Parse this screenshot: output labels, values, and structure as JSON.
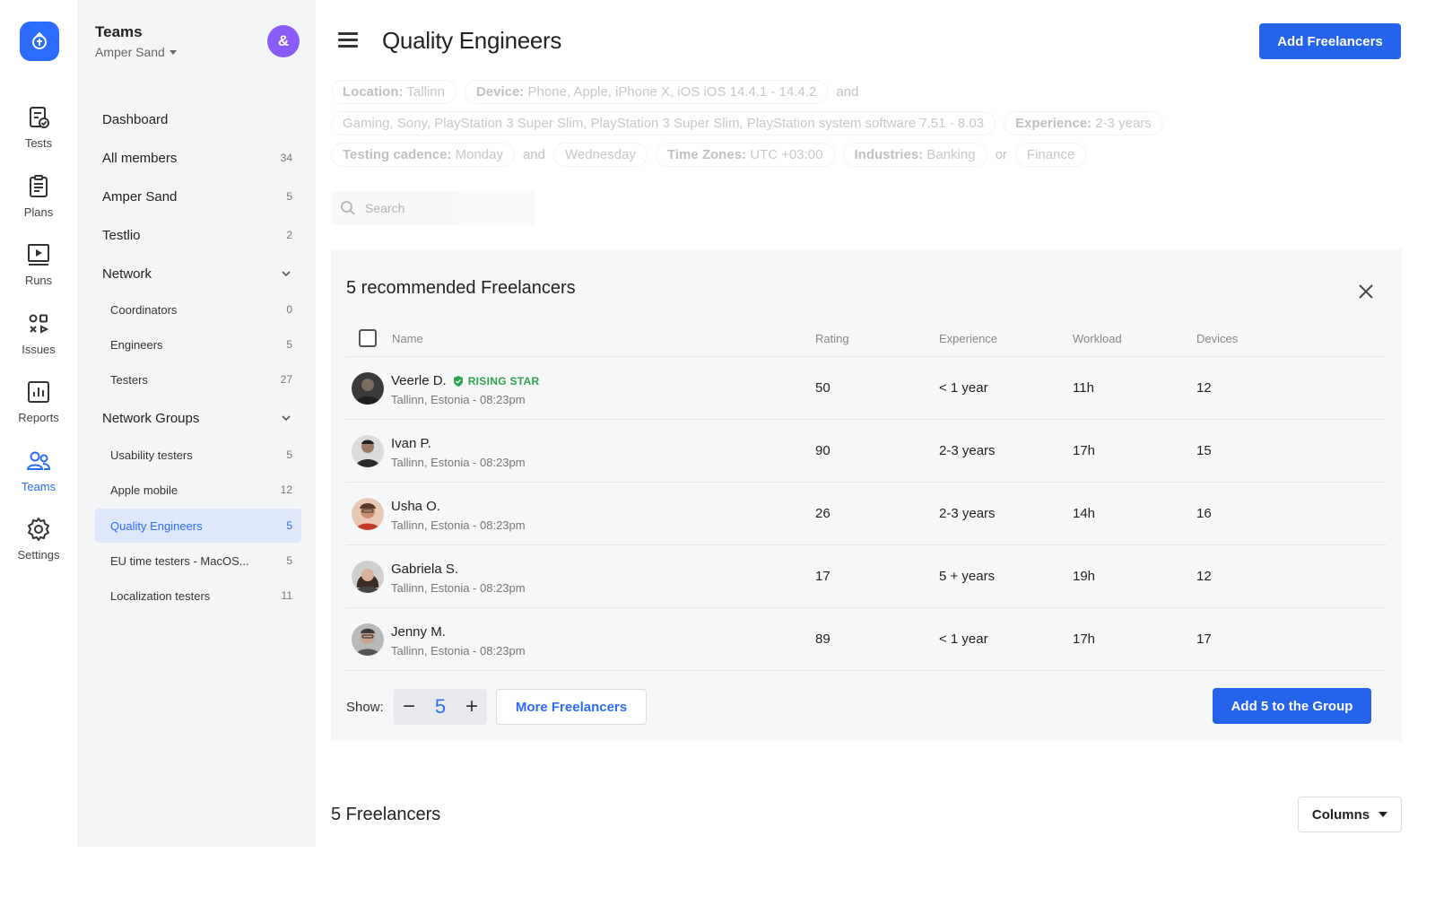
{
  "rail": {
    "items": [
      {
        "label": "Tests",
        "icon": "tests-icon"
      },
      {
        "label": "Plans",
        "icon": "plans-icon"
      },
      {
        "label": "Runs",
        "icon": "runs-icon"
      },
      {
        "label": "Issues",
        "icon": "issues-icon"
      },
      {
        "label": "Reports",
        "icon": "reports-icon"
      },
      {
        "label": "Teams",
        "icon": "teams-icon"
      },
      {
        "label": "Settings",
        "icon": "settings-icon"
      }
    ],
    "active": "Teams"
  },
  "sidebar": {
    "title": "Teams",
    "org": "Amper Sand",
    "items": [
      {
        "label": "Dashboard",
        "count": ""
      },
      {
        "label": "All members",
        "count": "34"
      },
      {
        "label": "Amper Sand",
        "count": "5"
      },
      {
        "label": "Testlio",
        "count": "2"
      },
      {
        "label": "Network",
        "count": ""
      },
      {
        "label": "Coordinators",
        "count": "0"
      },
      {
        "label": "Engineers",
        "count": "5"
      },
      {
        "label": "Testers",
        "count": "27"
      },
      {
        "label": "Network Groups",
        "count": ""
      },
      {
        "label": "Usability testers",
        "count": "5"
      },
      {
        "label": "Apple mobile",
        "count": "12"
      },
      {
        "label": "Quality Engineers",
        "count": "5"
      },
      {
        "label": "EU time testers - MacOS...",
        "count": "5"
      },
      {
        "label": "Localization testers",
        "count": "11"
      }
    ]
  },
  "header": {
    "title": "Quality Engineers",
    "add_button": "Add Freelancers"
  },
  "filters": {
    "location_key": "Location:",
    "location_val": "Tallinn",
    "device_key": "Device:",
    "device_val": "Phone, Apple, iPhone X, iOS iOS 14.4.1 - 14.4.2",
    "and1": "and",
    "gaming": "Gaming, Sony, PlayStation 3 Super Slim, PlayStation 3 Super Slim, PlayStation system software 7.51 - 8.03",
    "experience_key": "Experience:",
    "experience_val": "2-3 years",
    "cadence_key": "Testing cadence:",
    "cadence_val": "Monday",
    "and2": "and",
    "wednesday": "Wednesday",
    "tz_key": "Time Zones:",
    "tz_val": "UTC +03:00",
    "industries_key": "Industries:",
    "industries_val": "Banking",
    "or": "or",
    "finance": "Finance"
  },
  "search": {
    "placeholder": "Search"
  },
  "recommended": {
    "title": "5 recommended Freelancers",
    "columns": {
      "name": "Name",
      "rating": "Rating",
      "experience": "Experience",
      "workload": "Workload",
      "devices": "Devices"
    },
    "rows": [
      {
        "name": "Veerle D.",
        "badge": "RISING STAR",
        "location": "Tallinn, Estonia - 08:23pm",
        "rating": "50",
        "experience": "< 1 year",
        "workload": "11h",
        "devices": "12"
      },
      {
        "name": "Ivan P.",
        "badge": "",
        "location": "Tallinn, Estonia - 08:23pm",
        "rating": "90",
        "experience": "2-3 years",
        "workload": "17h",
        "devices": "15"
      },
      {
        "name": "Usha O.",
        "badge": "",
        "location": "Tallinn, Estonia - 08:23pm",
        "rating": "26",
        "experience": "2-3 years",
        "workload": "14h",
        "devices": "16"
      },
      {
        "name": "Gabriela S.",
        "badge": "",
        "location": "Tallinn, Estonia - 08:23pm",
        "rating": "17",
        "experience": "5 + years",
        "workload": "19h",
        "devices": "12"
      },
      {
        "name": "Jenny M.",
        "badge": "",
        "location": "Tallinn, Estonia - 08:23pm",
        "rating": "89",
        "experience": "< 1 year",
        "workload": "17h",
        "devices": "17"
      }
    ],
    "show_label": "Show:",
    "show_value": "5",
    "more_button": "More Freelancers",
    "add_group_button": "Add 5 to the Group"
  },
  "freelancers": {
    "title": "5 Freelancers",
    "columns_button": "Columns"
  },
  "colors": {
    "accent": "#2563eb",
    "badge_green": "#2fa34f",
    "avatar_purple": "#8a5cf6"
  }
}
